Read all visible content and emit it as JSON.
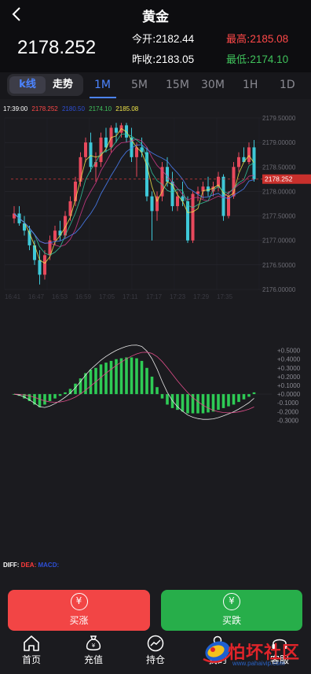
{
  "header": {
    "title": "黄金",
    "price": "2178.252",
    "open_label": "今开:",
    "open_value": "2182.44",
    "prev_label": "昨收:",
    "prev_value": "2183.05",
    "high_label": "最高:",
    "high_value": "2185.08",
    "low_label": "最低:",
    "low_value": "2174.10"
  },
  "tabs": {
    "kline": "k线",
    "trend": "走势",
    "timeframes": [
      "1M",
      "5M",
      "15M",
      "30M",
      "1H",
      "1D"
    ],
    "active_timeframe": "1M"
  },
  "chart_legend": {
    "time": "17:39:00",
    "v1": "2178.252",
    "v2": "2180.50",
    "v3": "2174.10",
    "v4": "2185.08"
  },
  "macd_legend": {
    "diff_label": "DIFF:",
    "dea_label": "DEA:",
    "macd_label": "MACD:"
  },
  "chart_data": {
    "type": "candlestick",
    "price_axis_ticks": [
      "2179.50000",
      "2179.00000",
      "2178.50000",
      "2178.00000",
      "2177.50000",
      "2177.00000",
      "2176.50000",
      "2176.00000"
    ],
    "price_range": [
      2176.0,
      2179.5
    ],
    "last_price_label": "2178.252",
    "time_ticks": [
      "16:41",
      "16:47",
      "16:53",
      "16:59",
      "17:05",
      "17:11",
      "17:17",
      "17:23",
      "17:29",
      "17:35"
    ],
    "macd_axis_ticks": [
      "+0.5000",
      "+0.4000",
      "+0.3000",
      "+0.2000",
      "+0.1000",
      "+0.0000",
      "-0.1000",
      "-0.2000",
      "-0.3000"
    ],
    "macd_range": [
      -0.35,
      0.55
    ],
    "candles": [
      [
        2177.45,
        2177.7,
        2177.35,
        2177.55
      ],
      [
        2177.55,
        2177.7,
        2177.3,
        2177.35
      ],
      [
        2177.35,
        2177.5,
        2177.1,
        2177.2
      ],
      [
        2177.2,
        2177.3,
        2176.8,
        2176.9
      ],
      [
        2176.9,
        2177.0,
        2176.5,
        2176.6
      ],
      [
        2176.6,
        2176.8,
        2176.1,
        2176.3
      ],
      [
        2176.3,
        2176.8,
        2176.2,
        2176.7
      ],
      [
        2176.7,
        2177.1,
        2176.6,
        2177.0
      ],
      [
        2177.0,
        2177.3,
        2176.9,
        2177.2
      ],
      [
        2177.2,
        2177.4,
        2177.0,
        2177.1
      ],
      [
        2177.1,
        2177.6,
        2177.05,
        2177.5
      ],
      [
        2177.5,
        2177.9,
        2177.4,
        2177.8
      ],
      [
        2177.8,
        2178.3,
        2177.7,
        2178.2
      ],
      [
        2178.2,
        2178.8,
        2178.1,
        2178.7
      ],
      [
        2178.7,
        2179.1,
        2178.6,
        2179.0
      ],
      [
        2179.0,
        2179.2,
        2178.4,
        2178.5
      ],
      [
        2178.5,
        2178.8,
        2178.2,
        2178.6
      ],
      [
        2178.6,
        2179.2,
        2178.5,
        2179.1
      ],
      [
        2179.1,
        2179.3,
        2178.8,
        2178.9
      ],
      [
        2178.9,
        2179.35,
        2178.8,
        2179.3
      ],
      [
        2179.3,
        2179.4,
        2179.0,
        2179.2
      ],
      [
        2179.2,
        2179.4,
        2179.1,
        2179.35
      ],
      [
        2179.35,
        2179.4,
        2179.0,
        2179.1
      ],
      [
        2179.1,
        2179.3,
        2178.6,
        2178.7
      ],
      [
        2178.7,
        2179.0,
        2178.3,
        2178.9
      ],
      [
        2178.9,
        2179.1,
        2178.7,
        2178.8
      ],
      [
        2178.8,
        2178.9,
        2177.8,
        2177.9
      ],
      [
        2177.9,
        2178.0,
        2177.0,
        2177.6
      ],
      [
        2177.6,
        2178.0,
        2177.4,
        2177.9
      ],
      [
        2177.9,
        2178.6,
        2177.8,
        2178.5
      ],
      [
        2178.5,
        2178.7,
        2178.1,
        2178.2
      ],
      [
        2178.2,
        2178.4,
        2177.6,
        2177.7
      ],
      [
        2177.7,
        2178.0,
        2177.6,
        2177.9
      ],
      [
        2177.9,
        2178.2,
        2177.7,
        2177.8
      ],
      [
        2177.8,
        2177.9,
        2176.95,
        2177.0
      ],
      [
        2177.0,
        2178.0,
        2176.95,
        2177.95
      ],
      [
        2177.95,
        2178.1,
        2177.8,
        2178.0
      ],
      [
        2178.0,
        2178.2,
        2177.85,
        2178.1
      ],
      [
        2178.1,
        2178.3,
        2177.9,
        2178.0
      ],
      [
        2178.0,
        2178.2,
        2177.9,
        2178.1
      ],
      [
        2178.1,
        2178.4,
        2178.0,
        2178.3
      ],
      [
        2178.3,
        2178.35,
        2177.4,
        2177.5
      ],
      [
        2177.5,
        2178.0,
        2177.45,
        2177.9
      ],
      [
        2177.9,
        2178.6,
        2177.85,
        2178.5
      ],
      [
        2178.5,
        2178.8,
        2178.4,
        2178.7
      ],
      [
        2178.7,
        2178.9,
        2178.6,
        2178.6
      ],
      [
        2178.6,
        2179.0,
        2178.55,
        2178.9
      ],
      [
        2178.9,
        2179.05,
        2178.2,
        2178.25
      ]
    ],
    "macd_histogram": [
      0.0,
      -0.02,
      -0.05,
      -0.08,
      -0.12,
      -0.15,
      -0.12,
      -0.08,
      -0.05,
      -0.02,
      0.02,
      0.06,
      0.12,
      0.18,
      0.24,
      0.28,
      0.3,
      0.34,
      0.36,
      0.38,
      0.4,
      0.41,
      0.42,
      0.42,
      0.41,
      0.38,
      0.3,
      0.2,
      0.08,
      -0.05,
      -0.12,
      -0.16,
      -0.18,
      -0.2,
      -0.22,
      -0.22,
      -0.22,
      -0.22,
      -0.21,
      -0.2,
      -0.18,
      -0.16,
      -0.14,
      -0.12,
      -0.09,
      -0.06,
      -0.03,
      0.02
    ],
    "ma_colors": [
      "#f0e64a",
      "#d23a8a",
      "#34c8a0",
      "#4c84ff"
    ]
  },
  "actions": {
    "buy_up_label": "买涨",
    "buy_down_label": "买跌",
    "currency_glyph": "¥"
  },
  "nav": {
    "items": [
      "首页",
      "充值",
      "持仓",
      "我的",
      "客服"
    ]
  },
  "watermark": {
    "text": "怕坏社区",
    "url": "www.pahaivip.com"
  },
  "colors": {
    "up": "#3fc25b",
    "down": "#ff4848",
    "accent": "#4c84ff",
    "candle_up": "#e8495c",
    "candle_down": "#3ec8d8",
    "macd_bar": "#2ecb55"
  }
}
